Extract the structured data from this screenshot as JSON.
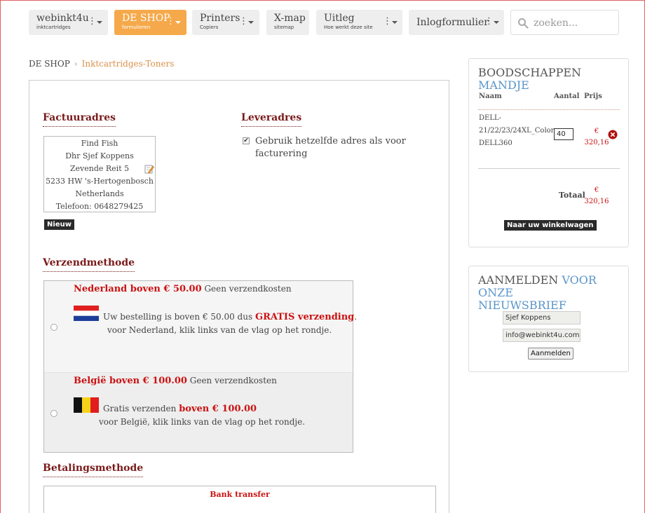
{
  "nav": {
    "items": [
      {
        "label": "webinkt4u",
        "sub": "inktcartridges"
      },
      {
        "label": "DE SHOP",
        "sub": "formulieren"
      },
      {
        "label": "Printers",
        "sub": "Copiers"
      },
      {
        "label": "X-map",
        "sub": "sitemap"
      },
      {
        "label": "Uitleg",
        "sub": "Hoe werkt deze site"
      },
      {
        "label": "Inlogformulier",
        "sub": ""
      }
    ],
    "dots": "⋮",
    "search_placeholder": "zoeken..."
  },
  "breadcrumb": {
    "home": "DE SHOP",
    "separator": "›",
    "current": "Inktcartridges-Toners"
  },
  "billing": {
    "title": "Factuuradres",
    "lines": [
      "Find Fish",
      "Dhr Sjef Koppens",
      "Zevende Reit 5",
      "5233 HW 's-Hertogenbosch",
      "Netherlands",
      "Telefoon: 0648279425"
    ],
    "new_button": "Nieuw"
  },
  "delivery": {
    "title": "Leveradres",
    "checkbox_label": "Gebruik hetzelfde adres als voor facturering",
    "checkbox_mark": "✔"
  },
  "shipping": {
    "title": "Verzendmethode",
    "options": [
      {
        "name": "Nederland boven € 50.00",
        "cost": "Geen verzendkosten",
        "desc1_pre": "Uw bestelling is boven € 50.00 dus",
        "desc1_bold": "GRATIS verzending",
        "desc1_post": ".",
        "desc2": "voor Nederland, klik links van de vlag op het rondje."
      },
      {
        "name": "België boven € 100.00",
        "cost": "Geen verzendkosten",
        "desc1_pre": "Gratis verzenden",
        "desc1_bold": "boven € 100.00",
        "desc2": "voor België, klik links van de vlag op het rondje."
      }
    ]
  },
  "payment": {
    "title": "Betalingsmethode",
    "option": "Bank transfer"
  },
  "cart": {
    "title_a": "BOODSCHAPPEN",
    "title_b": "MANDJE",
    "col_name": "Naam",
    "col_qty": "Aantal",
    "col_price": "Prijs",
    "item": {
      "name_l1": "DELL-",
      "name_l2": "21/22/23/24XL_Color",
      "name_l3": "DELL360",
      "qty": "40",
      "currency": "€",
      "price": "320,16"
    },
    "total_label": "Totaal",
    "total_currency": "€",
    "total": "320,16",
    "checkout_button": "Naar uw winkelwagen"
  },
  "newsletter": {
    "title_a": "AANMELDEN",
    "title_b": "VOOR ONZE",
    "title_c": "NIEUWSBRIEF",
    "name_value": "Sjef Koppens",
    "email_value": "info@webinkt4u.com",
    "submit": "Aanmelden"
  },
  "colors": {
    "accent_orange": "#f5a94a",
    "title_red": "#7a1a1a",
    "price_red": "#cc1111",
    "link_blue": "#5a95c8"
  }
}
